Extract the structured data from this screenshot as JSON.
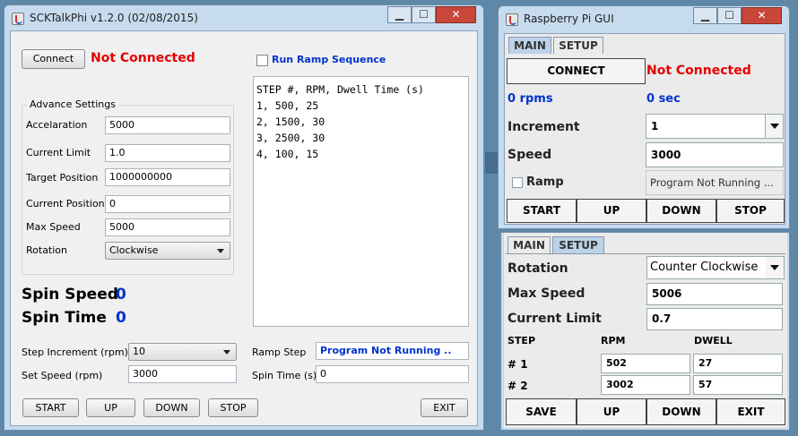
{
  "w1": {
    "title": "SCKTalkPhi v1.2.0 (02/08/2015)",
    "connect": "Connect",
    "status": "Not Connected",
    "ramp_seq": "Run Ramp Sequence",
    "adv_title": "Advance Settings",
    "fields": [
      {
        "label": "Accelaration",
        "value": "5000"
      },
      {
        "label": "Current Limit",
        "value": "1.0"
      },
      {
        "label": "Target Position",
        "value": "1000000000"
      },
      {
        "label": "Current Position",
        "value": "0"
      },
      {
        "label": "Max Speed",
        "value": "5000"
      }
    ],
    "rotation_label": "Rotation",
    "rotation_value": "Clockwise",
    "spin_speed_label": "Spin Speed",
    "spin_speed_value": "0",
    "spin_time_label": "Spin Time",
    "spin_time_value": "0",
    "ramp_lines": [
      "STEP #, RPM, Dwell Time (s)",
      "1, 500, 25",
      "2, 1500, 30",
      "3, 2500, 30",
      "4, 100, 15"
    ],
    "step_inc_label": "Step Increment (rpm)",
    "step_inc_value": "10",
    "set_speed_label": "Set Speed (rpm)",
    "set_speed_value": "3000",
    "ramp_step_label": "Ramp Step",
    "ramp_step_value": "Program Not Running ..",
    "spin_time_s_label": "Spin Time (s)",
    "spin_time_s_value": "0",
    "buttons": [
      "START",
      "UP",
      "DOWN",
      "STOP"
    ],
    "exit": "EXIT"
  },
  "w2": {
    "title": "Raspberry Pi GUI",
    "tabs": [
      "MAIN",
      "SETUP"
    ],
    "connect": "CONNECT",
    "status": "Not Connected",
    "rpms": "0 rpms",
    "sec": "0 sec",
    "increment_label": "Increment",
    "increment_value": "1",
    "speed_label": "Speed",
    "speed_value": "3000",
    "ramp_label": "Ramp",
    "ramp_status": "Program Not Running ...",
    "buttons": [
      "START",
      "UP",
      "DOWN",
      "STOP"
    ]
  },
  "w3": {
    "tabs": [
      "MAIN",
      "SETUP"
    ],
    "rotation_label": "Rotation",
    "rotation_value": "Counter Clockwise",
    "max_speed_label": "Max Speed",
    "max_speed_value": "5006",
    "current_limit_label": "Current Limit",
    "current_limit_value": "0.7",
    "col_step": "STEP",
    "col_rpm": "RPM",
    "col_dwell": "DWELL",
    "rows": [
      {
        "step": "# 1",
        "rpm": "502",
        "dwell": "27"
      },
      {
        "step": "# 2",
        "rpm": "3002",
        "dwell": "57"
      }
    ],
    "buttons": [
      "SAVE",
      "UP",
      "DOWN",
      "EXIT"
    ]
  },
  "colors": {
    "status_red": "#e60000",
    "value_blue": "#0033cc",
    "desktop": "#5e87a8"
  }
}
